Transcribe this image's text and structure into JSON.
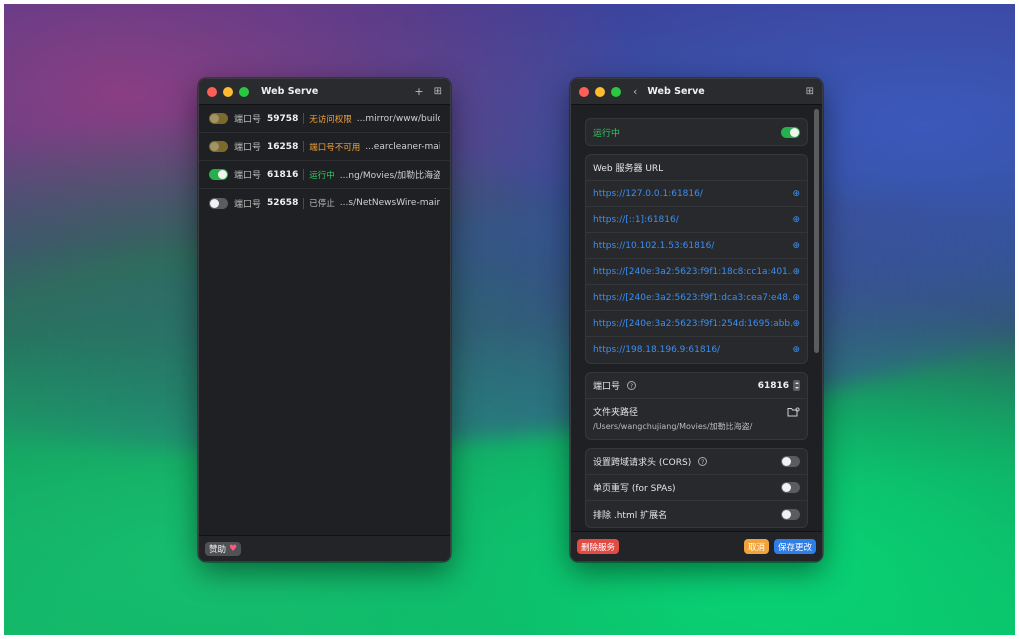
{
  "left_window": {
    "title": "Web Serve",
    "toolbar": {
      "add_icon": "plus-icon",
      "grid_icon": "grid-icon"
    },
    "servers": [
      {
        "port_label": "端口号",
        "port": "59758",
        "status": "无访问权限",
        "status_color": "#f0a33c",
        "toggle": "warn",
        "path": "...mirror/www/build/"
      },
      {
        "port_label": "端口号",
        "port": "16258",
        "status": "端口号不可用",
        "status_color": "#f0a33c",
        "toggle": "warn",
        "path": "...earcleaner-main/"
      },
      {
        "port_label": "端口号",
        "port": "61816",
        "status": "运行中",
        "status_color": "#2ecc61",
        "toggle": "on",
        "path": "...ng/Movies/加勒比海盗/"
      },
      {
        "port_label": "端口号",
        "port": "52658",
        "status": "已停止",
        "status_color": "#bdbdbd",
        "toggle": "off",
        "path": "...s/NetNewsWire-main/"
      }
    ],
    "footer": {
      "donate_label": "赞助",
      "heart": "♥"
    }
  },
  "right_window": {
    "title": "Web Serve",
    "back_icon": "chevron-left-icon",
    "status": {
      "label": "运行中",
      "toggle": "on"
    },
    "urls_header": "Web 服务器 URL",
    "urls": [
      "https://127.0.0.1:61816/",
      "https://[::1]:61816/",
      "https://10.102.1.53:61816/",
      "https://[240e:3a2:5623:f9f1:18c8:cc1a:401...",
      "https://[240e:3a2:5623:f9f1:dca3:cea7:e48...",
      "https://[240e:3a2:5623:f9f1:254d:1695:abb...",
      "https://198.18.196.9:61816/"
    ],
    "port": {
      "label": "端口号",
      "help": "?",
      "value": "61816"
    },
    "folder": {
      "label": "文件夹路径",
      "path": "/Users/wangchujiang/Movies/加勒比海盗/"
    },
    "options": [
      {
        "label": "设置跨域请求头 (CORS)",
        "help": true,
        "toggle": "off"
      },
      {
        "label": "单页重写 (for SPAs)",
        "help": false,
        "toggle": "off"
      },
      {
        "label": "排除 .html 扩展名",
        "help": false,
        "toggle": "off"
      }
    ],
    "footer": {
      "delete_label": "删除服务",
      "cancel_label": "取消",
      "save_label": "保存更改"
    }
  }
}
